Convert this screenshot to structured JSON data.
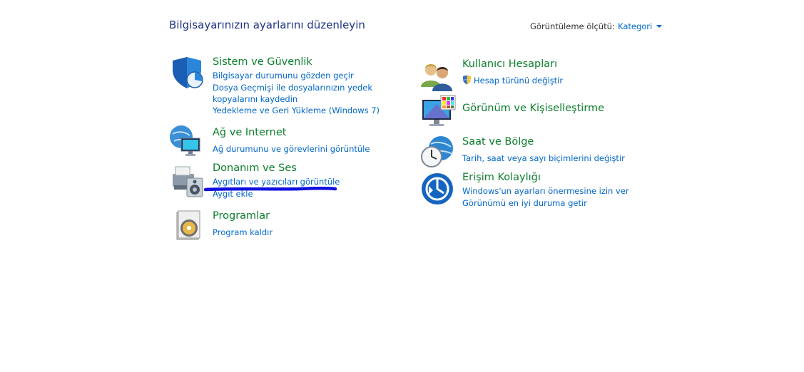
{
  "header": {
    "title": "Bilgisayarınızın ayarlarını düzenleyin",
    "view_by_label": "Görüntüleme ölçütü:",
    "view_by_value": "Kategori"
  },
  "left": [
    {
      "title": "Sistem ve Güvenlik",
      "icon": "security-shield-icon",
      "links": [
        "Bilgisayar durumunu gözden geçir",
        "Dosya Geçmişi ile dosyalarınızın yedek kopyalarını kaydedin",
        "Yedekleme ve Geri Yükleme (Windows 7)"
      ]
    },
    {
      "title": "Ağ ve Internet",
      "icon": "network-globe-icon",
      "links": [
        "Ağ durumunu ve görevlerini görüntüle"
      ]
    },
    {
      "title": "Donanım ve Ses",
      "icon": "printer-speaker-icon",
      "links": [
        "Aygıtları ve yazıcıları görüntüle",
        "Aygıt ekle"
      ]
    },
    {
      "title": "Programlar",
      "icon": "programs-disc-icon",
      "links": [
        "Program kaldır"
      ]
    }
  ],
  "right": [
    {
      "title": "Kullanıcı Hesapları",
      "icon": "users-icon",
      "links": [
        "Hesap türünü değiştir"
      ]
    },
    {
      "title": "Görünüm ve Kişiselleştirme",
      "icon": "monitor-palette-icon",
      "links": []
    },
    {
      "title": "Saat ve Bölge",
      "icon": "clock-globe-icon",
      "links": [
        "Tarih, saat veya sayı biçimlerini değiştir"
      ]
    },
    {
      "title": "Erişim Kolaylığı",
      "icon": "accessibility-icon",
      "links": [
        "Windows'un ayarları önermesine izin ver",
        "Görünümü en iyi duruma getir"
      ]
    }
  ],
  "colors": {
    "title_green": "#0c7e2c",
    "link_blue": "#0066cc",
    "header_blue": "#1e3287",
    "annotation_stroke": "#1010e0"
  }
}
